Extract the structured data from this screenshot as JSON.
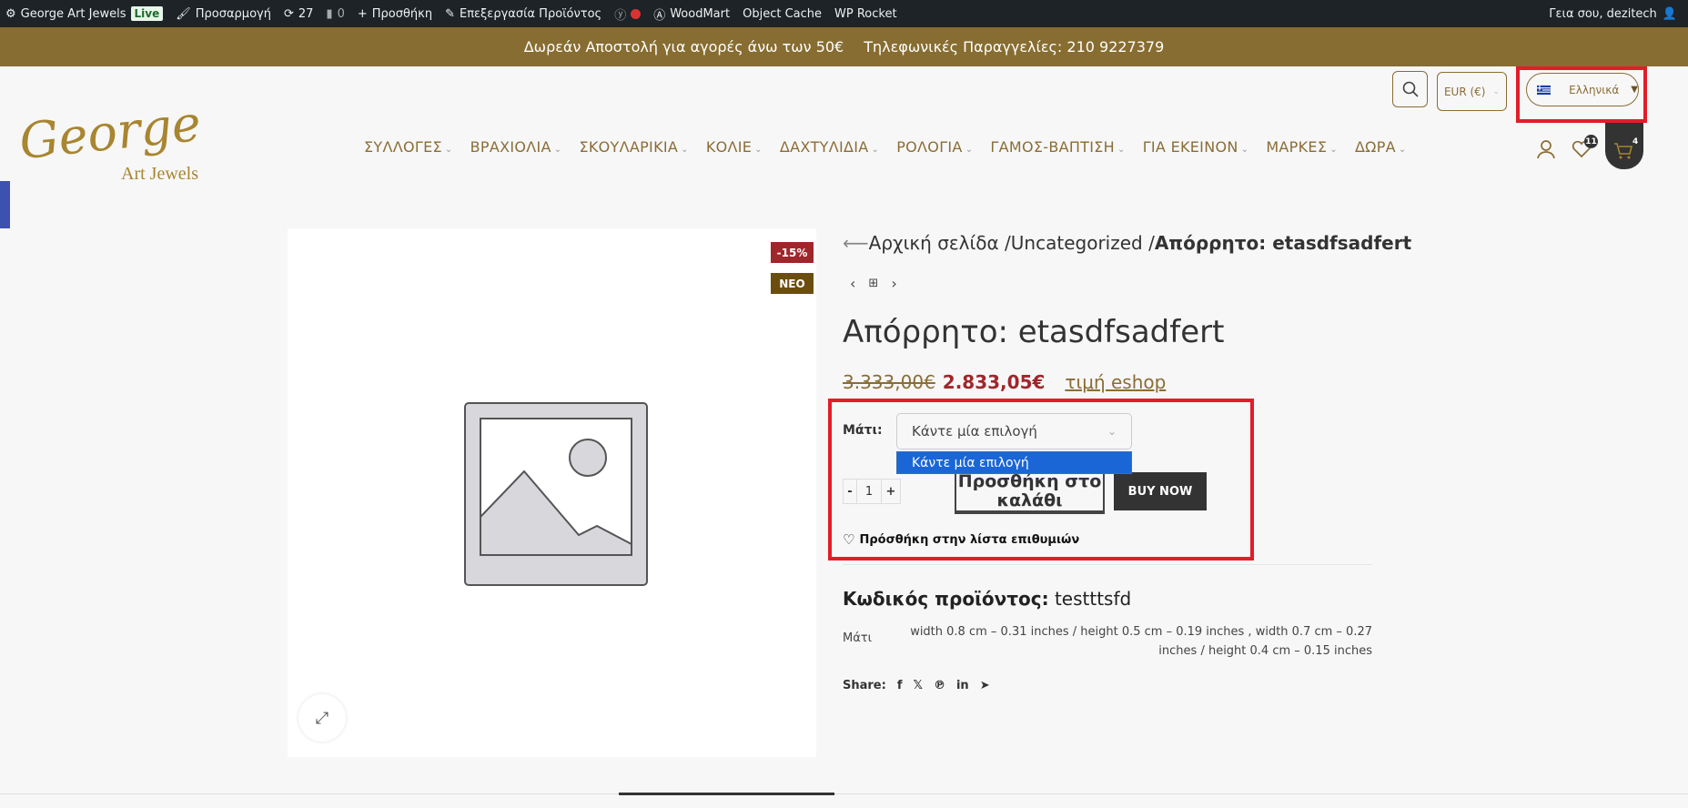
{
  "adminbar": {
    "site": "George Art Jewels",
    "live": "Live",
    "customize": "Προσαρμογή",
    "updates": "27",
    "comments": "0",
    "new": "Προσθήκη",
    "edit": "Επεξεργασία Προϊόντος",
    "woodmart": "WoodMart",
    "object_cache": "Object Cache",
    "wp_rocket": "WP Rocket",
    "greeting": "Γεια σου, dezitech"
  },
  "banner": {
    "shipping": "Δωρεάν Αποστολή για αγορές άνω των 50€",
    "phone": "Τηλεφωνικές Παραγγελίες: 210 9227379"
  },
  "header": {
    "logo_main": "George",
    "logo_sub": "Art Jewels",
    "currency": "EUR (€)",
    "language": "Ελληνικά",
    "wishlist_count": "11",
    "cart_count": "4"
  },
  "nav": [
    "ΣΥΛΛΟΓΕΣ",
    "ΒΡΑΧΙΟΛΙΑ",
    "ΣΚΟΥΛΑΡΙΚΙΑ",
    "ΚΟΛΙΕ",
    "ΔΑΧΤΥΛΙΔΙΑ",
    "ΡΟΛΟΓΙΑ",
    "ΓΑΜΟΣ-ΒΑΠΤΙΣΗ",
    "ΓΙΑ ΕΚΕΙΝΟΝ",
    "ΜΑΡΚΕΣ",
    "ΔΩΡΑ"
  ],
  "product": {
    "badge_sale": "-15%",
    "badge_new": "NEO",
    "breadcrumb_home": "Αρχική σελίδα /",
    "breadcrumb_cat": "Uncategorized /",
    "breadcrumb_current": "Απόρρητο: etasdfsadfert",
    "title": "Απόρρητο: etasdfsadfert",
    "price_old": "3.333,00€",
    "price_new": "2.833,05€",
    "price_note": "τιμή eshop",
    "attr_label": "Μάτι:",
    "select_value": "Κάντε μία επιλογή",
    "select_option": "Κάντε μία επιλογή",
    "qty": "1",
    "qty_minus": "-",
    "qty_plus": "+",
    "add_to_cart": "Προσθήκη στο καλάθι",
    "buy_now": "BUY NOW",
    "wishlist": "Πρόσθήκη στην λίστα επιθυμιών",
    "sku_label": "Κωδικός προϊόντος:",
    "sku": "testttsfd",
    "attr_name": "Μάτι",
    "attr_value": "width 0.8 cm – 0.31 inches / height 0.5 cm – 0.19 inches , width 0.7 cm – 0.27 inches / height 0.4 cm – 0.15 inches",
    "share": "Share:"
  },
  "colors": {
    "gold": "#876d31",
    "sale": "#a0262b",
    "new_badge": "#6b4e0f",
    "highlight": "#e11d2a",
    "option": "#1a66d6"
  }
}
